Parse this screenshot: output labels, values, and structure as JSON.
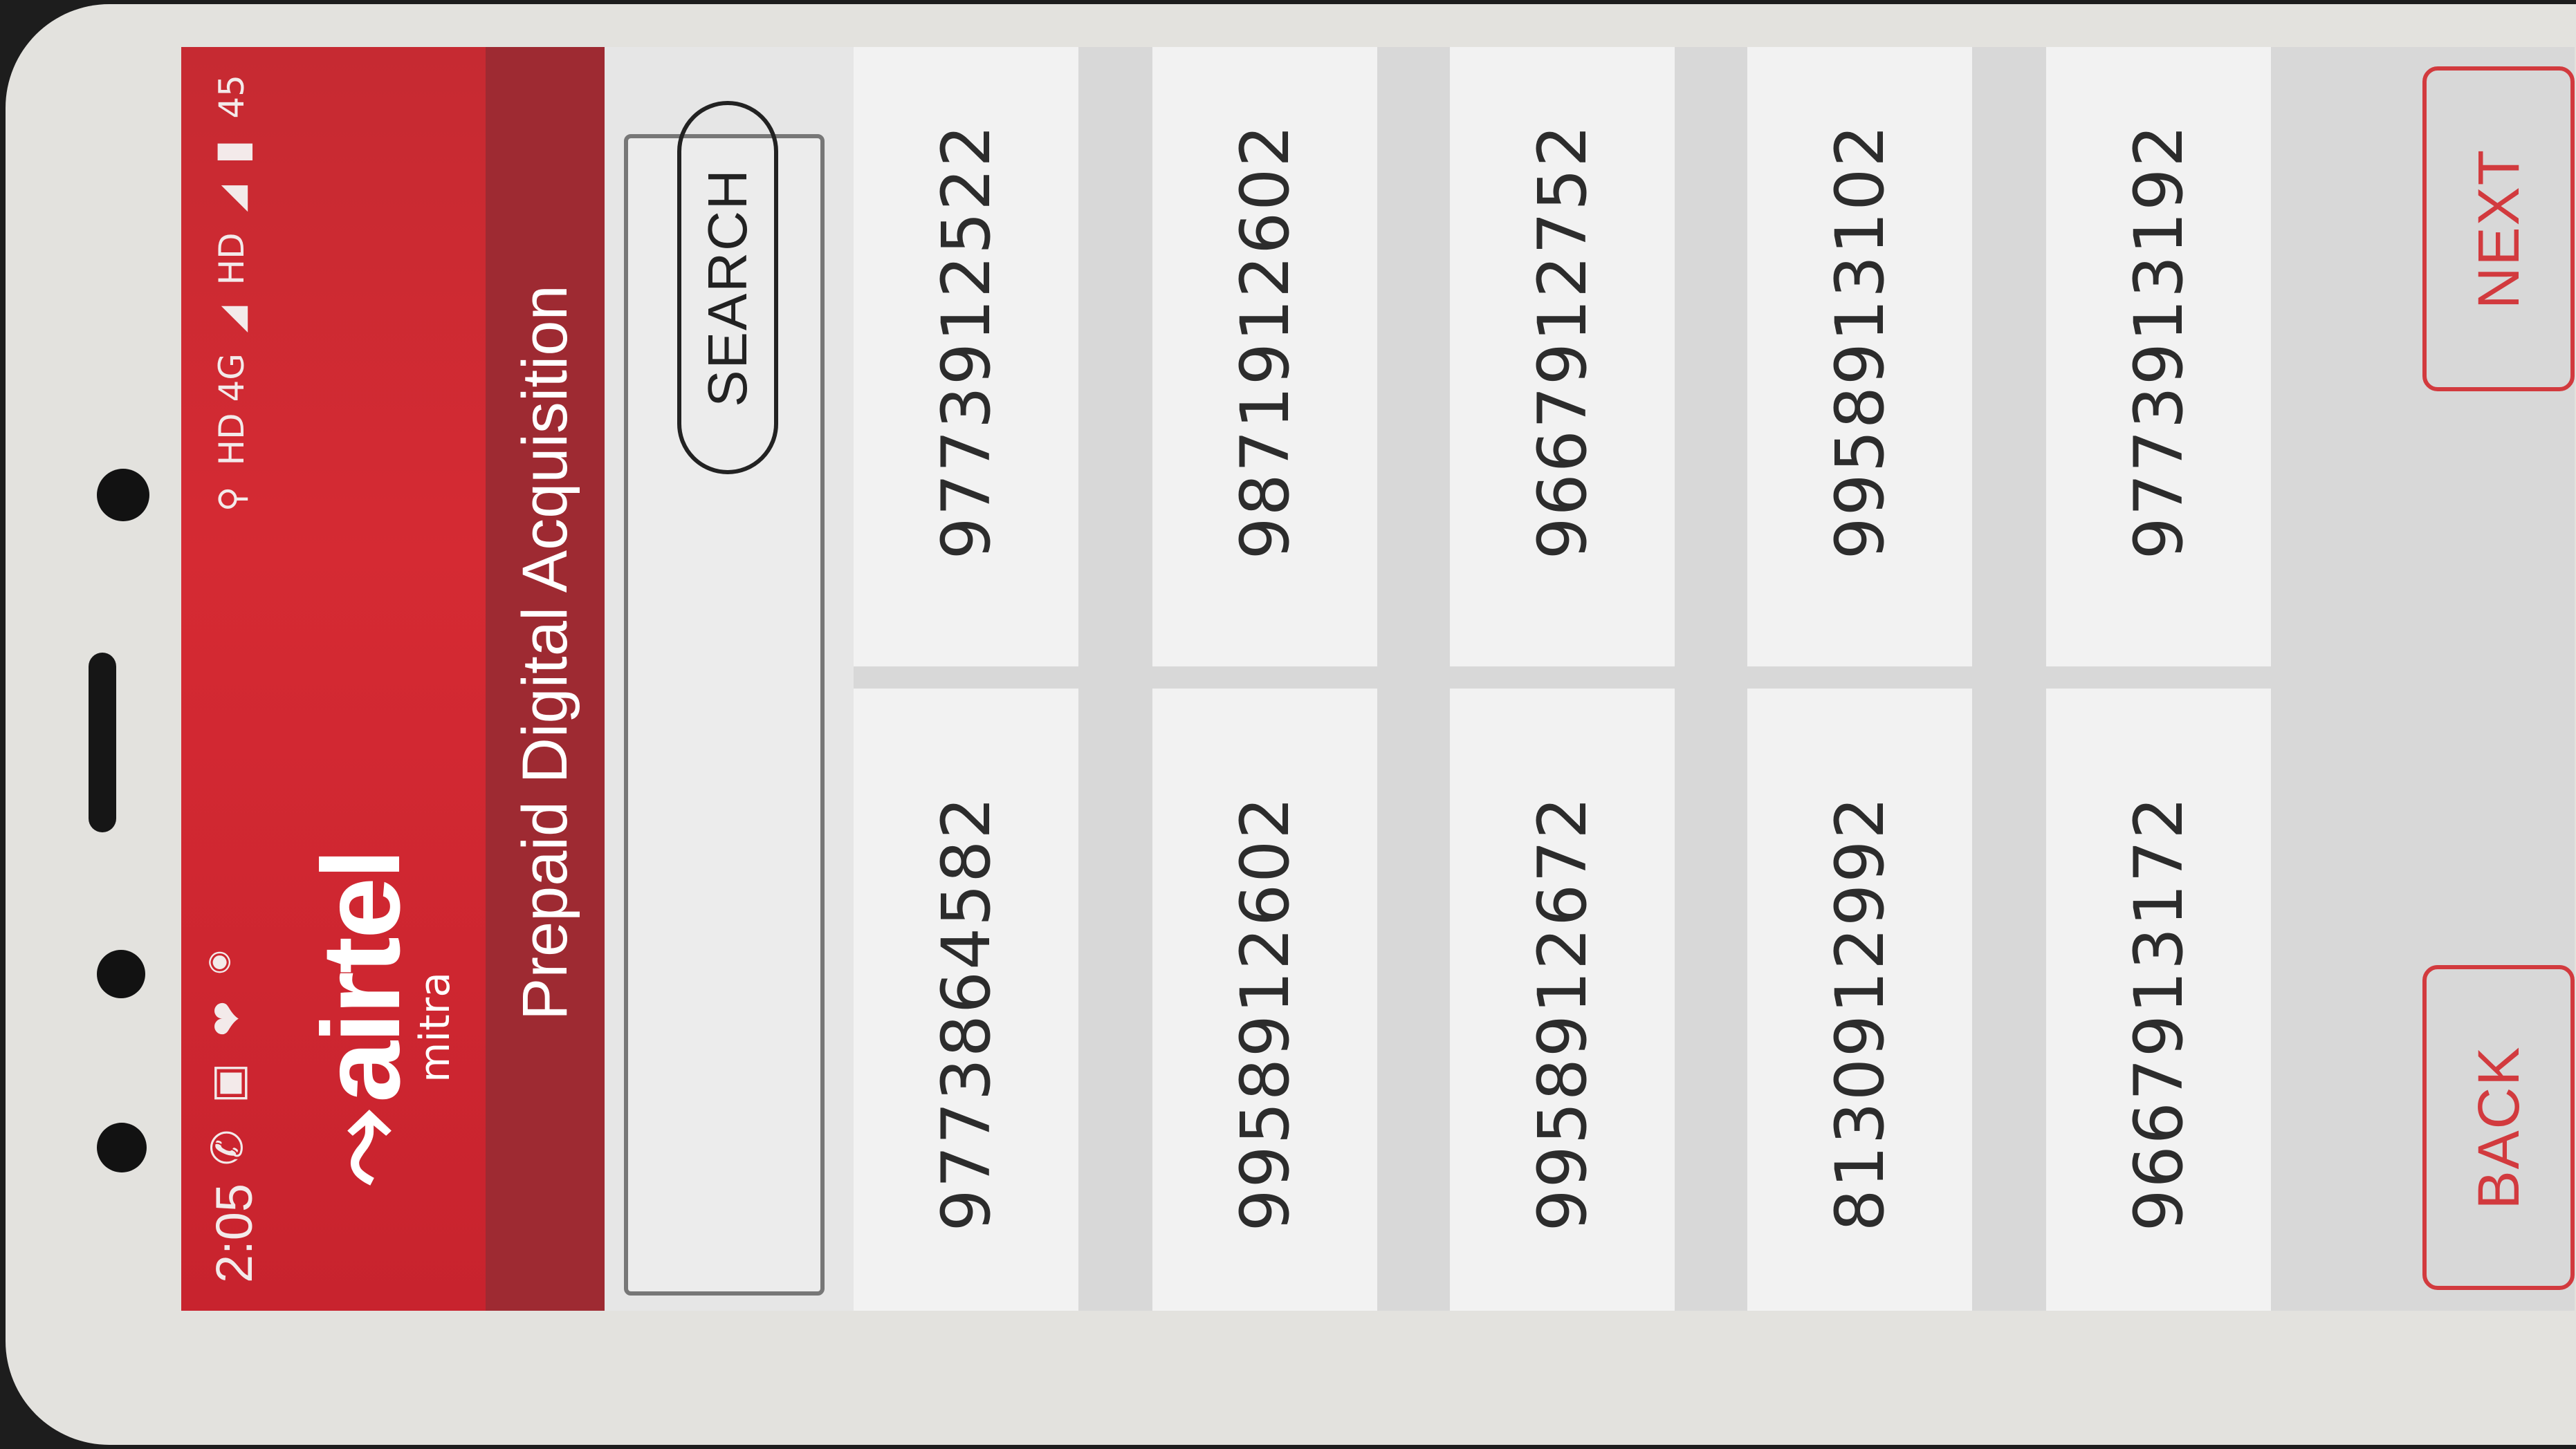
{
  "status_bar": {
    "time": "2:05",
    "network": "HD 4G",
    "network2": "HD",
    "battery": "45",
    "icons_left": [
      "whatsapp-icon",
      "gallery-icon",
      "heart-icon",
      "recorder-icon"
    ],
    "icons_right": [
      "location-icon",
      "signal-icon",
      "signal-icon",
      "battery-icon"
    ]
  },
  "brand": {
    "name": "airtel",
    "sub": "mitra"
  },
  "page": {
    "title": "Prepaid Digital Acquisition"
  },
  "search": {
    "value": "",
    "button_label": "SEARCH"
  },
  "numbers": [
    "9773864582",
    "9773912522",
    "9958912602",
    "9871912602",
    "9958912672",
    "9667912752",
    "8130912992",
    "9958913102",
    "9667913172",
    "9773913192"
  ],
  "nav": {
    "back_label": "BACK",
    "next_label": "NEXT"
  },
  "colors": {
    "brand_red": "#d52a33",
    "title_bar": "#9e2a32",
    "button_red": "#d23a3e"
  }
}
